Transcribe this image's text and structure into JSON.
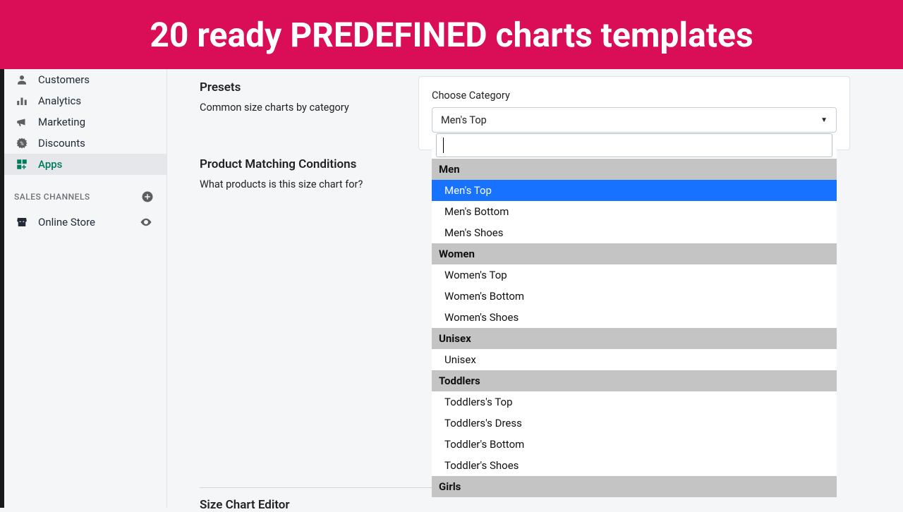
{
  "banner": {
    "title": "20 ready PREDEFINED charts templates"
  },
  "sidebar": {
    "items": [
      {
        "label": "Customers"
      },
      {
        "label": "Analytics"
      },
      {
        "label": "Marketing"
      },
      {
        "label": "Discounts"
      },
      {
        "label": "Apps"
      }
    ],
    "section_label": "SALES CHANNELS",
    "channels": [
      {
        "label": "Online Store"
      }
    ]
  },
  "presets": {
    "heading": "Presets",
    "description": "Common size charts by category"
  },
  "matching": {
    "heading": "Product Matching Conditions",
    "description": "What products is this size chart for?"
  },
  "editor": {
    "heading": "Size Chart Editor"
  },
  "category": {
    "label": "Choose Category",
    "selected": "Men's Top",
    "search_value": "",
    "groups": [
      {
        "name": "Men",
        "options": [
          "Men's Top",
          "Men's Bottom",
          "Men's Shoes"
        ]
      },
      {
        "name": "Women",
        "options": [
          "Women's Top",
          "Women's Bottom",
          "Women's Shoes"
        ]
      },
      {
        "name": "Unisex",
        "options": [
          "Unisex"
        ]
      },
      {
        "name": "Toddlers",
        "options": [
          "Toddlers's Top",
          "Toddlers's Dress",
          "Toddler's Bottom",
          "Toddler's Shoes"
        ]
      },
      {
        "name": "Girls",
        "options": []
      }
    ],
    "highlighted": "Men's Top"
  }
}
